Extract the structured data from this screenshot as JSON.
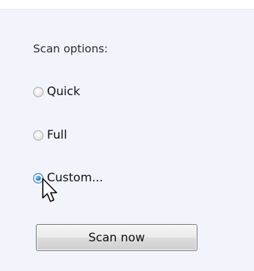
{
  "scan_options": {
    "label": "Scan options:",
    "options": [
      {
        "label": "Quick",
        "selected": false
      },
      {
        "label": "Full",
        "selected": false
      },
      {
        "label": "Custom...",
        "selected": true
      }
    ]
  },
  "actions": {
    "scan_button_label": "Scan now"
  },
  "icons": {
    "cursor": "mouse-pointer-icon"
  },
  "colors": {
    "panel_background": "#f1f5fb",
    "selected_radio_accent": "#1f82cc"
  }
}
